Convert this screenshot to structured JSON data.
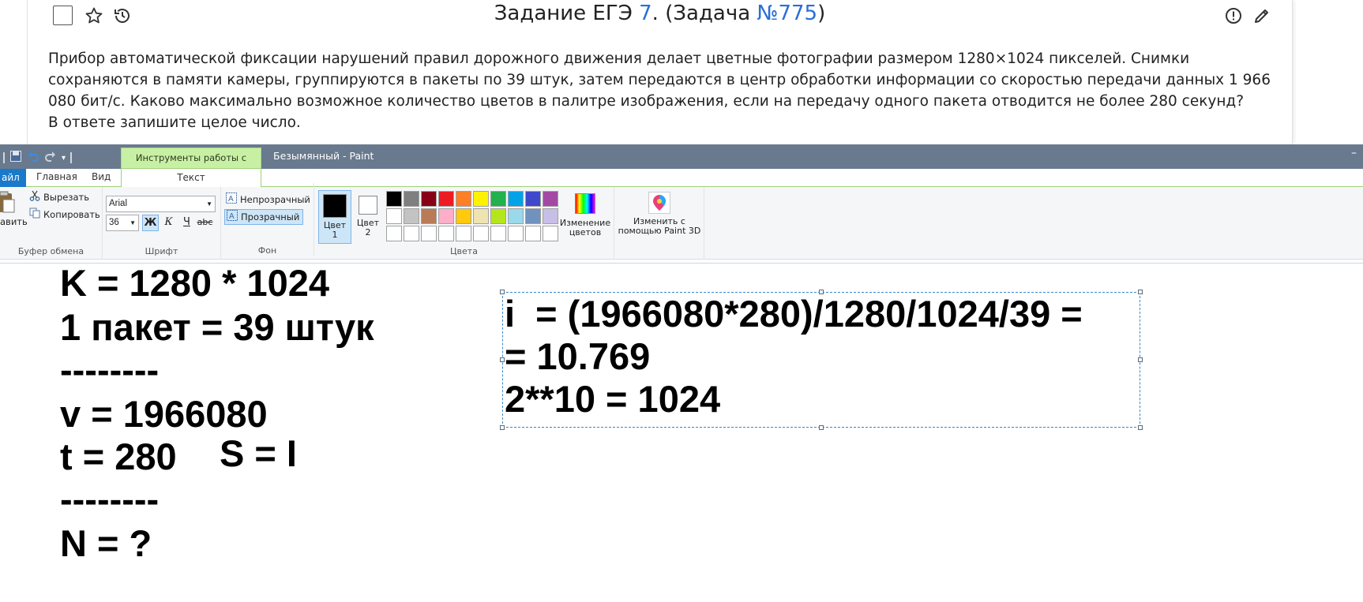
{
  "task": {
    "title_prefix": "Задание ЕГЭ ",
    "title_num": "7",
    "title_mid": ". (Задача ",
    "title_link": "№775",
    "title_suffix": ")",
    "body_lines": [
      "Прибор автоматической фиксации нарушений правил дорожного движения делает цветные фотографии размером 1280×1024 пикселей. Снимки",
      "сохраняются в памяти камеры, группируются в пакеты по 39 штук, затем передаются в центр обработки информации со скоростью передачи данных 1 966",
      "080 бит/с. Каково максимально возможное количество цветов в палитре изображения, если на передачу одного пакета отводится не более 280 секунд?",
      "В ответе запишите целое число."
    ],
    "icons": {
      "favorite": "star-icon",
      "history": "history-icon",
      "report": "alert-icon",
      "edit": "pencil-icon"
    }
  },
  "paint": {
    "context_tab": "Инструменты работы с текстом",
    "window_title": "Безымянный - Paint",
    "window_control": "–",
    "tabs": {
      "file": "айл",
      "home": "Главная",
      "view": "Вид",
      "text": "Текст"
    },
    "clipboard": {
      "paste": "авить",
      "cut": "Вырезать",
      "copy": "Копировать",
      "label": "Буфер обмена"
    },
    "font": {
      "name": "Arial",
      "size": "36",
      "bold": "Ж",
      "italic": "К",
      "underline": "Ч",
      "strike": "abc",
      "label": "Шрифт"
    },
    "background": {
      "opaque": "Непрозрачный",
      "transparent": "Прозрачный",
      "label": "Фон"
    },
    "colors": {
      "color1": "Цвет 1",
      "color2": "Цвет 2",
      "edit_colors": "Изменение цветов",
      "label": "Цвета",
      "color1_value": "#000000",
      "color2_value": "#ffffff",
      "palette_row1": [
        "#000000",
        "#7f7f7f",
        "#880015",
        "#ed1c24",
        "#ff7f27",
        "#fff200",
        "#22b14c",
        "#00a2e8",
        "#3f48cc",
        "#a349a4"
      ],
      "palette_row2": [
        "#ffffff",
        "#c3c3c3",
        "#b97a57",
        "#ffaec9",
        "#ffc90e",
        "#efe4b0",
        "#b5e61d",
        "#99d9ea",
        "#7092be",
        "#c8bfe7"
      ]
    },
    "paint3d": "Изменить с помощью Paint 3D"
  },
  "canvas": {
    "left_lines": [
      "K = 1280 * 1024",
      "1 пакет = 39 штук",
      "--------",
      "v = 1966080",
      "t = 280",
      "--------",
      "N = ?"
    ],
    "s_eq": "S = I",
    "box_lines": [
      "i  = (1966080*280)/1280/1024/39 =",
      "= 10.769",
      "2**10 = 1024"
    ]
  }
}
